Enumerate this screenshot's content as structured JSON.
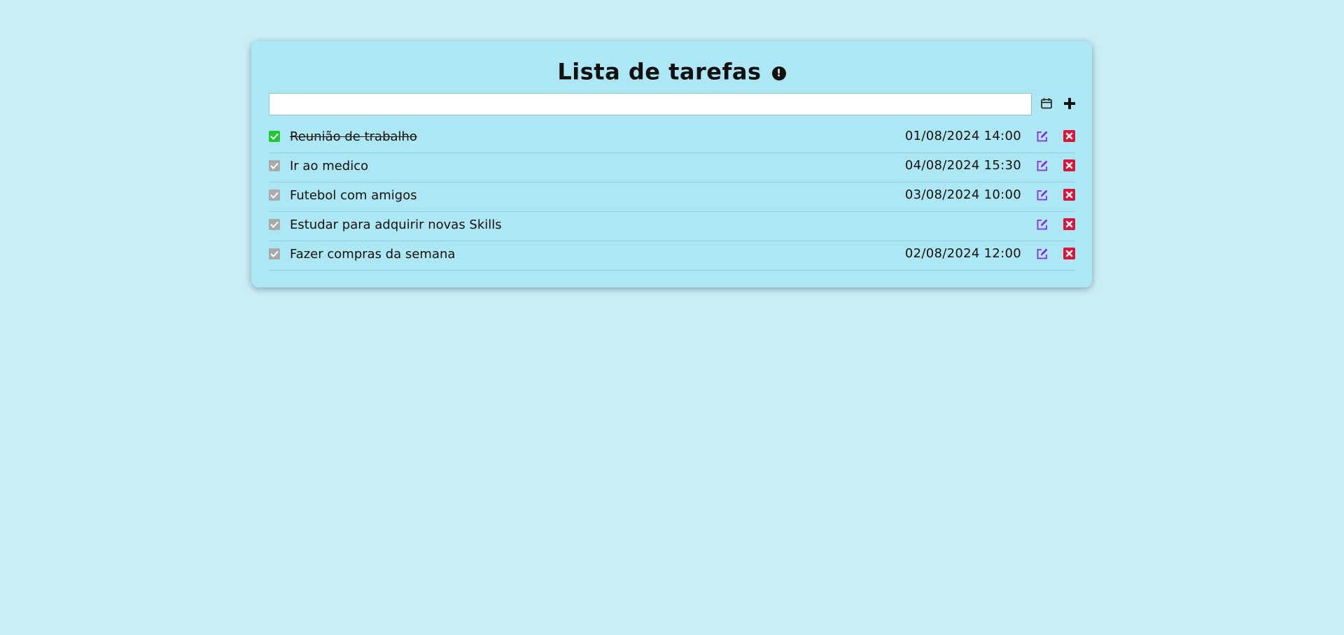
{
  "header": {
    "title": "Lista de tarefas",
    "info_icon": "exclamation-circle-icon",
    "info_glyph": "!"
  },
  "input": {
    "value": "",
    "placeholder": "",
    "calendar_icon": "calendar-icon",
    "add_icon": "plus-icon"
  },
  "tasks": [
    {
      "text": "Reunião de trabalho",
      "date": "01/08/2024 14:00",
      "done": true
    },
    {
      "text": "Ir ao medico",
      "date": "04/08/2024 15:30",
      "done": false
    },
    {
      "text": "Futebol com amigos",
      "date": "03/08/2024 10:00",
      "done": false
    },
    {
      "text": "Estudar para adquirir novas Skills",
      "date": "",
      "done": false
    },
    {
      "text": "Fazer compras da semana",
      "date": "02/08/2024 12:00",
      "done": false
    }
  ],
  "icons": {
    "edit": "edit-icon",
    "delete": "delete-x-icon",
    "checkbox": "checkbox-check-icon"
  },
  "colors": {
    "background": "#c9eff6",
    "card": "#ade7f3",
    "done_checkbox": "#22c733",
    "pending_checkbox": "#aaaaaa",
    "edit": "#8a2be2",
    "delete": "#d6173d"
  }
}
